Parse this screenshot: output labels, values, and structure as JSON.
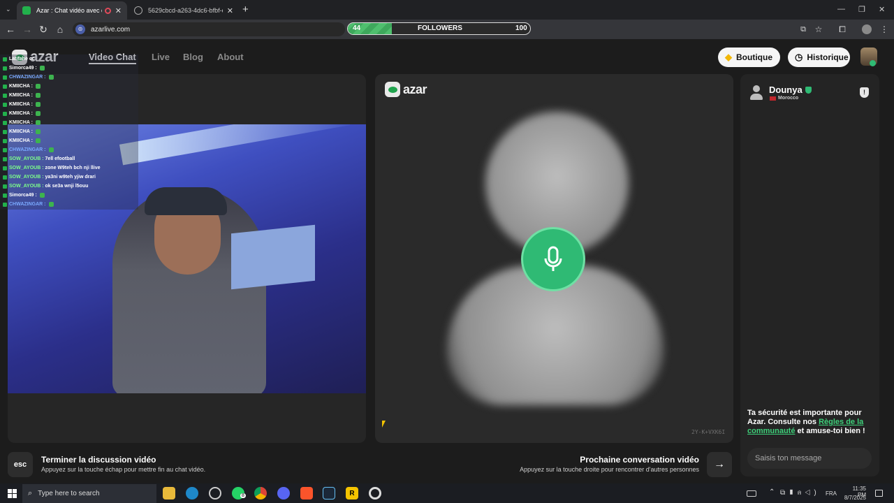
{
  "browser": {
    "tabs": [
      {
        "label": "Azar : Chat vidéo avec de r",
        "close": "✕"
      },
      {
        "label": "5629cbcd-a263-4dc6-bfbf-c65",
        "close": "✕"
      }
    ],
    "new_tab": "+",
    "url": "azarlive.com",
    "followers": {
      "start": "44",
      "label": "FOLLOWERS",
      "end": "100",
      "progress": 0.24
    },
    "window_controls": [
      "—",
      "❐",
      "✕"
    ]
  },
  "header": {
    "logo_text": "azar",
    "nav": [
      "Video Chat",
      "Live",
      "Blog",
      "About"
    ],
    "boutique_label": "Boutique",
    "historique_label": "Historique"
  },
  "chat_overlay": [
    {
      "name": "Latifahe",
      "msg": "cc",
      "emote": false
    },
    {
      "name": "Simorca49 :",
      "msg": "",
      "emote": true
    },
    {
      "name": "CHWAZINGAR :",
      "msg": "",
      "emote": true
    },
    {
      "name": "KMIICHA :",
      "msg": "",
      "emote": true
    },
    {
      "name": "KMIICHA :",
      "msg": "",
      "emote": true
    },
    {
      "name": "KMIICHA :",
      "msg": "",
      "emote": true
    },
    {
      "name": "KMIICHA :",
      "msg": "",
      "emote": true
    },
    {
      "name": "KMIICHA :",
      "msg": "",
      "emote": true
    },
    {
      "name": "KMIICHA :",
      "msg": "",
      "emote": true
    },
    {
      "name": "KMIICHA :",
      "msg": "",
      "emote": true
    },
    {
      "name": "CHWAZINGAR :",
      "msg": "",
      "emote": true
    },
    {
      "name": "SOW_AYOUB :",
      "msg": "7ell efootball",
      "emote": false
    },
    {
      "name": "SOW_AYOUB :",
      "msg": "zone W9teh bch nji llive",
      "emote": false
    },
    {
      "name": "SOW_AYOUB :",
      "msg": "ya3ni w9teh yjiw drari",
      "emote": false
    },
    {
      "name": "SOW_AYOUB :",
      "msg": "ok se3a wnji l5ouu",
      "emote": false
    },
    {
      "name": "Simorca49 :",
      "msg": "",
      "emote": true
    },
    {
      "name": "CHWAZINGAR :",
      "msg": "",
      "emote": true
    }
  ],
  "remote": {
    "logo_text": "azar",
    "session_code": "2Y-K+VXK6I"
  },
  "partner": {
    "name": "Dounya",
    "country": "Morocco"
  },
  "safety": {
    "text1": "Ta sécurité est importante pour Azar. Consulte nos ",
    "link": "Règles de la communauté",
    "text2": " et amuse-toi bien !"
  },
  "message_placeholder": "Saisis ton message",
  "controls": {
    "esc_label": "esc",
    "end_title": "Terminer la discussion vidéo",
    "end_sub": "Appuyez sur la touche échap pour mettre fin au chat vidéo.",
    "next_title": "Prochaine conversation vidéo",
    "next_sub": "Appuyez sur la touche droite pour rencontrer d'autres personnes"
  },
  "taskbar": {
    "search_placeholder": "Type here to search",
    "lang": "FRA",
    "time": "11:35 PM",
    "date": "8/7/2025",
    "whatsapp_badge": "8"
  },
  "colors": {
    "accent": "#2fba74",
    "link": "#3ed07a",
    "follower_bar": "#4fbf6e"
  }
}
